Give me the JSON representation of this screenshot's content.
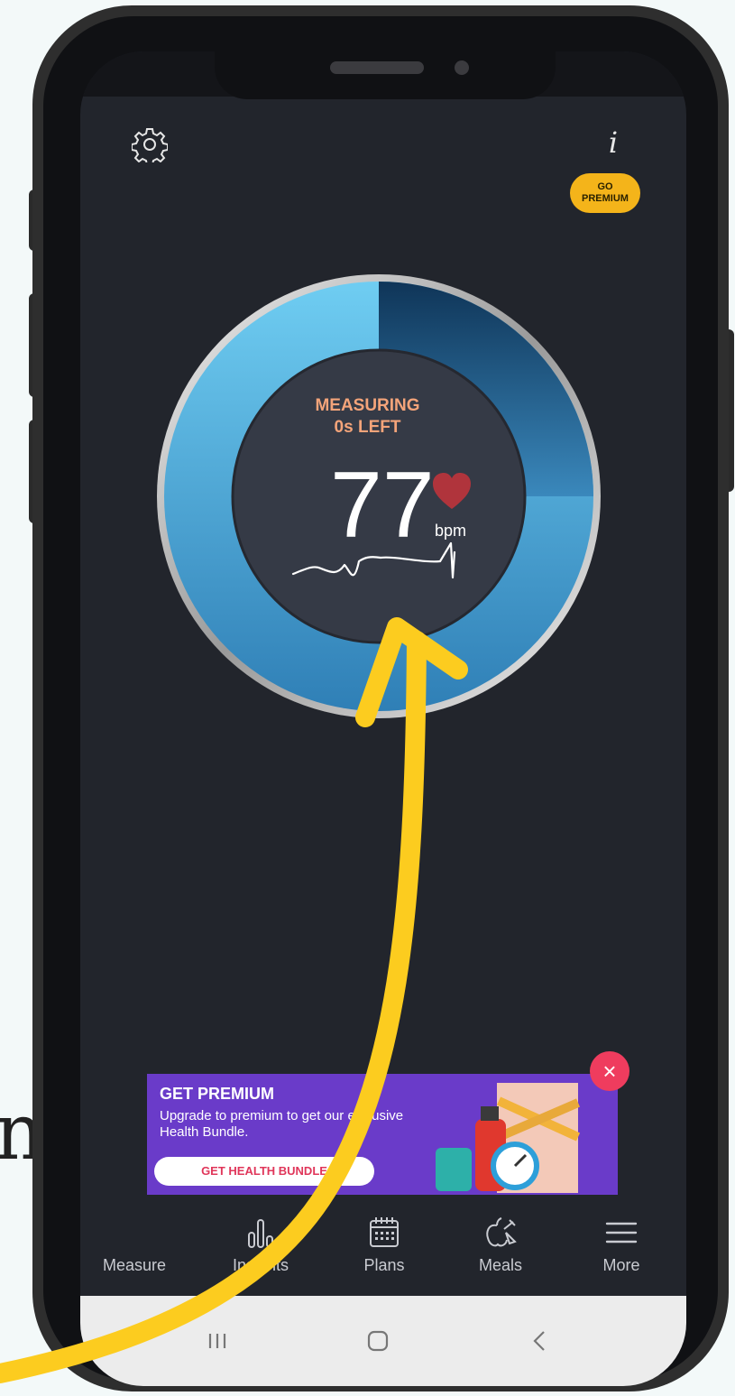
{
  "background_text": "n",
  "top": {
    "settings_icon": "gear-icon",
    "info_label": "i",
    "premium_badge": [
      "GO",
      "PREMIUM"
    ]
  },
  "dial": {
    "status": "MEASURING",
    "time_left": "0s LEFT",
    "bpm_value": "77",
    "bpm_unit": "bpm",
    "progress_fraction": 0.25
  },
  "promo": {
    "title": "GET PREMIUM",
    "body": "Upgrade to premium to get our exclusive Health Bundle.",
    "button": "GET HEALTH BUNDLE",
    "close": "×"
  },
  "tabs": [
    {
      "label": "Measure",
      "icon": "heart-icon"
    },
    {
      "label": "Insights",
      "icon": "bar-chart-icon"
    },
    {
      "label": "Plans",
      "icon": "calendar-icon"
    },
    {
      "label": "Meals",
      "icon": "apple-carrot-icon"
    },
    {
      "label": "More",
      "icon": "menu-icon"
    }
  ],
  "system_nav": [
    "recent-apps-icon",
    "home-icon",
    "back-icon"
  ],
  "colors": {
    "accent_orange": "#f4a47a",
    "premium_yellow": "#f4b41a",
    "promo_purple": "#6a3bc9",
    "arrow_yellow": "#fccc1f",
    "dial_light": "#6cc8f0",
    "dial_dark": "#124064"
  }
}
